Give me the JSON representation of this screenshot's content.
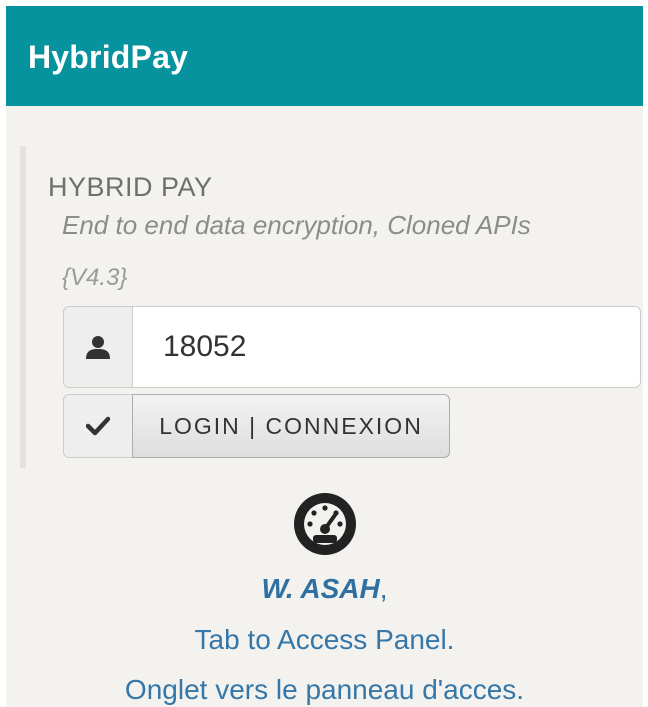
{
  "app": {
    "title": "HybridPay"
  },
  "header": {
    "brand": "HYBRID PAY",
    "subtitle": "End to end data encryption, Cloned APIs",
    "version": "{V4.3}"
  },
  "login_form": {
    "user_id_value": "18052",
    "user_icon": "user-icon",
    "check_icon": "checkmark-icon",
    "login_label": "LOGIN | CONNEXION"
  },
  "access": {
    "icon": "dashboard-gauge-icon",
    "user_name": "W. ASAH",
    "name_suffix": ",",
    "tab_en": "Tab to Access Panel.",
    "tab_fr": "Onglet vers le panneau d'acces."
  },
  "colors": {
    "toolbar": "#07939e",
    "background": "#f3f2ef",
    "link_blue": "#2f6fa1"
  }
}
